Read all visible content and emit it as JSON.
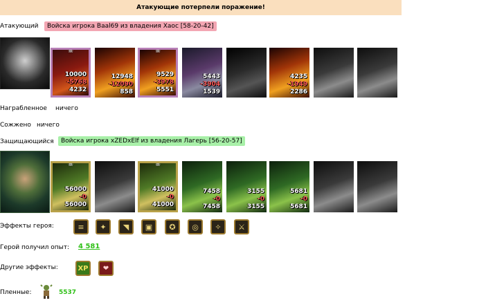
{
  "result_banner": "Атакующие потерпели поражение!",
  "attacker": {
    "label": "Атакующий",
    "army_title": "Войска игрока Baal69 из владения Хаос [58-20-42]",
    "units": [
      {
        "name": "unit-red-demon",
        "framed": true,
        "color": "c-red",
        "count": "10000",
        "lost": "-5768",
        "left": "4232"
      },
      {
        "name": "unit-fire-imp",
        "framed": false,
        "color": "c-fire",
        "count": "12948",
        "lost": "-12090",
        "left": "858"
      },
      {
        "name": "unit-fire-demon",
        "framed": true,
        "color": "c-fire",
        "count": "9529",
        "lost": "-3978",
        "left": "5551"
      },
      {
        "name": "unit-purple-dragon",
        "framed": false,
        "color": "c-purple",
        "count": "5443",
        "lost": "-3904",
        "left": "1539"
      },
      {
        "name": "unit-gray-beast",
        "framed": false,
        "color": "c-dark",
        "count": "",
        "lost": "",
        "left": ""
      },
      {
        "name": "unit-fire-lord",
        "framed": false,
        "color": "c-fire",
        "count": "4235",
        "lost": "-1949",
        "left": "2286"
      },
      {
        "name": "unit-gray-warrior",
        "framed": false,
        "color": "c-gray",
        "count": "",
        "lost": "",
        "left": ""
      },
      {
        "name": "unit-gray-ghost",
        "framed": false,
        "color": "c-gray",
        "count": "",
        "lost": "",
        "left": ""
      }
    ]
  },
  "loot": {
    "label": "Награбленное",
    "value": "ничего"
  },
  "burned": {
    "label": "Сожжено",
    "value": "ничего"
  },
  "defender": {
    "label": "Защищающийся",
    "army_title": "Войска игрока xZEDxElf из владения Лагерь [56-20-57]",
    "units": [
      {
        "name": "unit-elf-archer",
        "framed": true,
        "color": "c-gold",
        "count": "56000",
        "lost": "-0",
        "left": "56000"
      },
      {
        "name": "unit-gray-knight",
        "framed": false,
        "color": "c-gray",
        "count": "",
        "lost": "",
        "left": ""
      },
      {
        "name": "unit-elf-paladin",
        "framed": true,
        "color": "c-gold",
        "count": "41000",
        "lost": "-0",
        "left": "41000"
      },
      {
        "name": "unit-green-griffin",
        "framed": false,
        "color": "c-green",
        "count": "7458",
        "lost": "-0",
        "left": "7458"
      },
      {
        "name": "unit-green-ranger",
        "framed": false,
        "color": "c-green",
        "count": "3155",
        "lost": "-0",
        "left": "3155"
      },
      {
        "name": "unit-green-druid",
        "framed": false,
        "color": "c-green",
        "count": "5681",
        "lost": "-0",
        "left": "5681"
      },
      {
        "name": "unit-gray-monk",
        "framed": false,
        "color": "c-gray",
        "count": "",
        "lost": "",
        "left": ""
      },
      {
        "name": "unit-gray-sorcerer",
        "framed": false,
        "color": "c-gray",
        "count": "",
        "lost": "",
        "left": ""
      }
    ]
  },
  "hero_effects": {
    "label": "Эффекты героя:",
    "icons": [
      {
        "name": "scroll-icon",
        "glyph": "≡"
      },
      {
        "name": "wand-icon",
        "glyph": "✦"
      },
      {
        "name": "horn-icon",
        "glyph": "◥"
      },
      {
        "name": "chest-icon",
        "glyph": "▣"
      },
      {
        "name": "pentagram-icon",
        "glyph": "✪"
      },
      {
        "name": "ring-icon",
        "glyph": "◎"
      },
      {
        "name": "staff-icon",
        "glyph": "✧"
      },
      {
        "name": "sword-icon",
        "glyph": "⚔"
      }
    ]
  },
  "experience": {
    "label": "Герой получил опыт:",
    "value": "4 581"
  },
  "other_effects": {
    "label": "Другие эффекты:",
    "xp_badge": "XP"
  },
  "prisoners": {
    "label": "Пленные:",
    "count": "5537"
  },
  "colors": {
    "attacker_tag": "#f3a6b3",
    "defender_tag": "#a8f0a8",
    "banner": "#fadfbe",
    "xp_green": "#30c018"
  }
}
